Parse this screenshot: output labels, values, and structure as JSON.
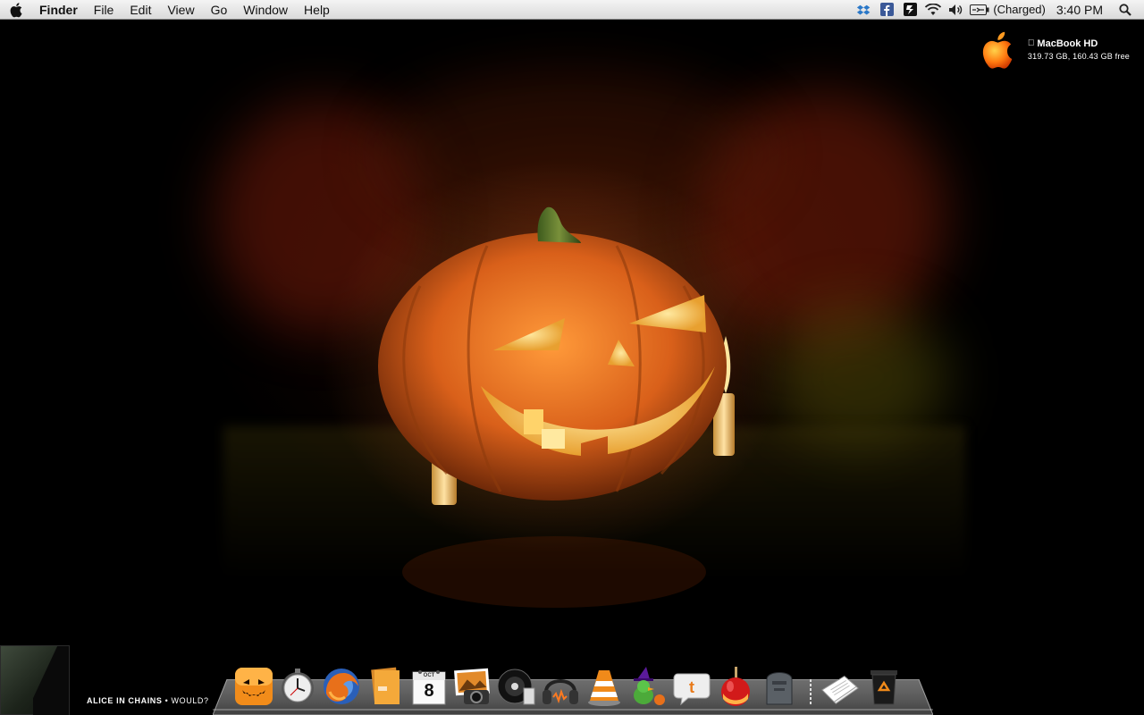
{
  "menubar": {
    "app_name": "Finder",
    "menus": [
      "File",
      "Edit",
      "View",
      "Go",
      "Window",
      "Help"
    ],
    "status_icons": [
      "dropbox-icon",
      "facebook-icon",
      "evernote-icon",
      "wifi-icon",
      "volume-icon",
      "battery-icon"
    ],
    "battery_text": "(Charged)",
    "clock": "3:40 PM"
  },
  "drive": {
    "name": "MacBook HD",
    "info": "319.73 GB, 160.43 GB free"
  },
  "now_playing": {
    "artist": "ALICE IN CHAINS",
    "separator": "•",
    "song": "WOULD?"
  },
  "dock": {
    "apps": [
      "pumpkin-finder-icon",
      "clock-icon",
      "firefox-icon",
      "stack-icon",
      "calendar-icon",
      "iphoto-icon",
      "dvd-player-icon",
      "headphones-itunes-icon",
      "vlc-icon",
      "adium-witch-duck-icon",
      "twitter-bird-icon",
      "candy-apple-icon",
      "tombstone-icon"
    ],
    "calendar_month": "OCT",
    "calendar_day": "8",
    "trash": [
      "documents-stack-icon",
      "trash-can-icon"
    ]
  },
  "colors": {
    "pumpkin": "#e0661a",
    "flame": "#ffd36a",
    "menubar": "#e6e6e6"
  }
}
